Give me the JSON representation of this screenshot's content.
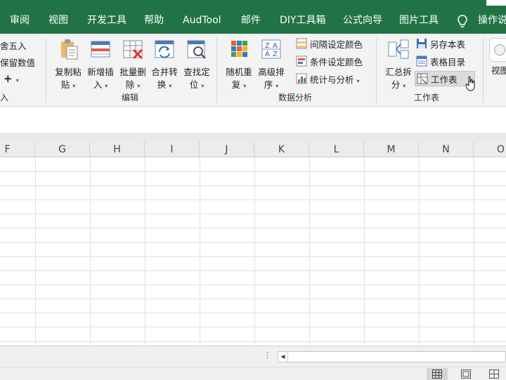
{
  "tabs": [
    "审阅",
    "视图",
    "开发工具",
    "帮助",
    "AudTool",
    "邮件",
    "DIY工具箱",
    "公式向导",
    "图片工具",
    "操作说"
  ],
  "left_fragment": {
    "row1": "舍五入",
    "row2": "保留数值",
    "row3_symbol": "+",
    "group_label": "入"
  },
  "edit_group": {
    "label": "编辑",
    "buttons": [
      {
        "line1": "复制粘",
        "line2": "贴",
        "icon": "paste-icon"
      },
      {
        "line1": "新增插",
        "line2": "入",
        "icon": "insert-row-icon"
      },
      {
        "line1": "批量删",
        "line2": "除",
        "icon": "delete-table-icon"
      },
      {
        "line1": "合并转",
        "line2": "换",
        "icon": "merge-convert-icon"
      },
      {
        "line1": "查找定",
        "line2": "位",
        "icon": "find-locate-icon"
      }
    ]
  },
  "analysis_group": {
    "label": "数据分析",
    "buttons": [
      {
        "line1": "随机重",
        "line2": "复",
        "icon": "random-repeat-icon"
      },
      {
        "line1": "高级排",
        "line2": "序",
        "icon": "sort-az-icon"
      }
    ],
    "items": [
      {
        "label": "间隔设定颜色",
        "icon": "interval-color-icon"
      },
      {
        "label": "条件设定颜色",
        "icon": "condition-color-icon"
      },
      {
        "label": "统计与分析",
        "icon": "stats-icon"
      }
    ]
  },
  "worksheet_group": {
    "label": "工作表",
    "big_button": {
      "line1": "汇总拆",
      "line2": "分",
      "icon": "summary-split-icon"
    },
    "items": [
      {
        "label": "另存本表",
        "icon": "save-sheet-icon"
      },
      {
        "label": "表格目录",
        "icon": "table-catalog-icon"
      },
      {
        "label": "工作表",
        "icon": "worksheet-icon"
      }
    ]
  },
  "view_fragment": {
    "label": "视图"
  },
  "columns": [
    "F",
    "G",
    "H",
    "I",
    "J",
    "K",
    "L",
    "M",
    "N",
    "O"
  ],
  "colors": {
    "tab_green": "#217346",
    "ribbon_bg": "#f3f3f3",
    "hover": "#dcdcdc"
  }
}
